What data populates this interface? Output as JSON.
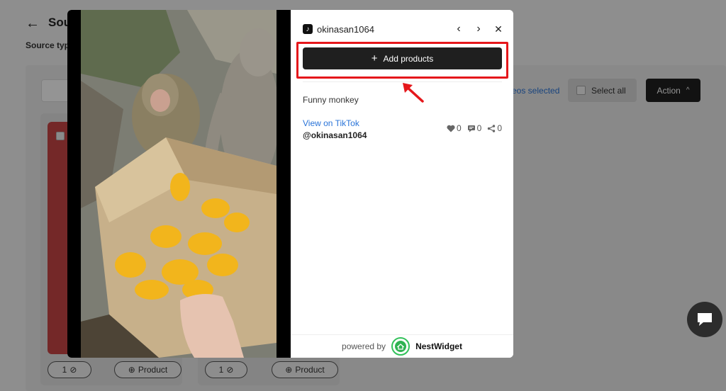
{
  "background": {
    "back_icon": "arrow-left-icon",
    "title": "Sou",
    "source_label": "Source typ",
    "selected_text": "eos selected",
    "select_all_label": "Select all",
    "action_label": "Action",
    "action_icon": "chevron-up-icon",
    "cards": [
      {
        "tag_count": "1",
        "product_label": "Product"
      },
      {
        "tag_count": "1",
        "product_label": "Product"
      }
    ]
  },
  "modal": {
    "video": {
      "description": "monkeys reaching into a cardboard box of snack packets"
    },
    "header": {
      "platform_icon": "tiktok-icon",
      "username": "okinasan1064",
      "prev_icon": "chevron-left-icon",
      "next_icon": "chevron-right-icon",
      "close_icon": "close-icon"
    },
    "add_products_label": "Add products",
    "caption": "Funny monkey",
    "view_link": "View on TikTok",
    "handle": "@okinasan1064",
    "stats": {
      "likes": "0",
      "comments": "0",
      "shares": "0"
    },
    "footer": {
      "powered_by": "powered by",
      "brand": "NestWidget"
    }
  },
  "colors": {
    "highlight": "#e5171b",
    "primary_button": "#1f1f1f",
    "link": "#2a74d8",
    "brand_green": "#2fb352"
  }
}
